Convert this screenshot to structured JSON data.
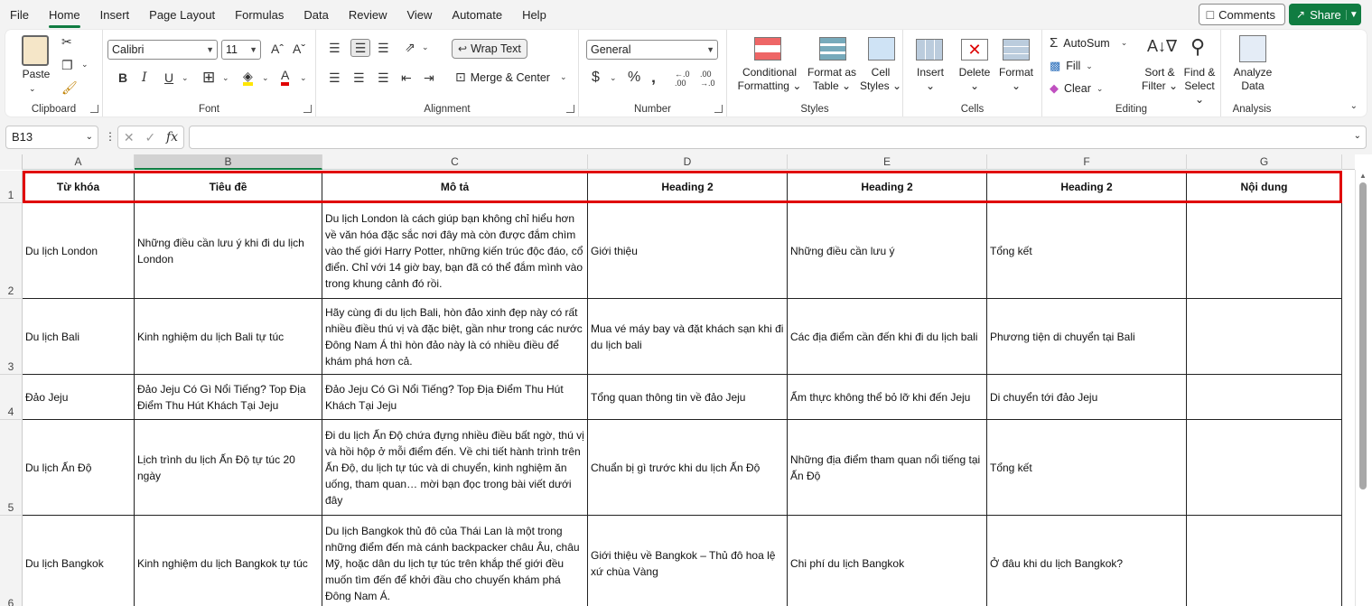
{
  "menu": {
    "tabs": [
      "File",
      "Home",
      "Insert",
      "Page Layout",
      "Formulas",
      "Data",
      "Review",
      "View",
      "Automate",
      "Help"
    ],
    "active": "Home",
    "comments_label": "Comments",
    "share_label": "Share"
  },
  "ribbon": {
    "clipboard": {
      "label": "Clipboard",
      "paste": "Paste"
    },
    "font": {
      "label": "Font",
      "font_name": "Calibri",
      "font_size": "11"
    },
    "alignment": {
      "label": "Alignment",
      "wrap_text": "Wrap Text",
      "merge_center": "Merge & Center"
    },
    "number": {
      "label": "Number",
      "format": "General"
    },
    "styles": {
      "label": "Styles",
      "conditional": "Conditional",
      "conditional2": "Formatting",
      "format_as": "Format as",
      "table": "Table",
      "cell": "Cell",
      "cell_styles": "Styles"
    },
    "cells": {
      "label": "Cells",
      "insert": "Insert",
      "delete": "Delete",
      "format": "Format"
    },
    "editing": {
      "label": "Editing",
      "autosum": "AutoSum",
      "fill": "Fill",
      "clear": "Clear",
      "sort": "Sort &",
      "filter": "Filter",
      "find": "Find &",
      "select": "Select"
    },
    "analysis": {
      "label": "Analysis",
      "analyze": "Analyze",
      "data": "Data"
    }
  },
  "formula_bar": {
    "name_box": "B13",
    "formula": ""
  },
  "columns": [
    "A",
    "B",
    "C",
    "D",
    "E",
    "F",
    "G"
  ],
  "selected_column": "B",
  "rows": [
    {
      "num": "1",
      "cells": [
        "Từ khóa",
        "Tiêu đề",
        "Mô tả",
        "Heading 2",
        "Heading 2",
        "Heading 2",
        "Nội dung"
      ]
    },
    {
      "num": "2",
      "cells": [
        "Du lịch London",
        "Những điều cần lưu ý khi đi du lịch London",
        "Du lịch London là cách giúp bạn không chỉ hiểu hơn về văn hóa đặc sắc nơi đây mà còn được đắm chìm vào thế giới Harry Potter, những kiến trúc độc đáo, cổ điển. Chỉ với 14 giờ bay, bạn đã có thể đắm mình vào trong khung cảnh đó rồi.",
        "Giới thiệu",
        "Những điều cần lưu ý",
        "Tổng kết",
        ""
      ]
    },
    {
      "num": "3",
      "cells": [
        "Du lịch Bali",
        "Kinh nghiệm du lịch Bali tự túc",
        "Hãy cùng đi du lịch Bali, hòn đảo xinh đẹp này có rất nhiều điều thú vị và đặc biệt, gần như trong các nước Đông Nam Á thì hòn đảo này là có nhiều điều để khám phá hơn cả.",
        "Mua vé máy bay và đặt khách sạn khi đi du lịch bali",
        "Các địa điểm cần đến khi đi du lịch bali",
        "Phương tiện di chuyển tại Bali",
        ""
      ]
    },
    {
      "num": "4",
      "cells": [
        "Đảo Jeju",
        "Đảo Jeju Có Gì Nổi Tiếng? Top Địa Điểm Thu Hút Khách Tại Jeju",
        "Đảo Jeju Có Gì Nổi Tiếng? Top Địa Điểm Thu Hút Khách Tại Jeju",
        "Tổng quan thông tin về đảo Jeju",
        "Ẩm thực không thể bỏ lỡ khi đến Jeju",
        "Di chuyển tới đảo Jeju",
        ""
      ]
    },
    {
      "num": "5",
      "cells": [
        "Du lịch Ấn Độ",
        "Lịch trình du lịch Ấn Độ tự túc 20 ngày",
        "Đi du lịch Ấn Độ chứa đựng nhiều điều bất ngờ, thú vị và hồi hộp ở mỗi điểm đến. Về chi tiết hành trình trên Ấn Độ, du lịch tự túc và di chuyển, kinh nghiệm ăn uống, tham quan… mời bạn đọc trong bài viết dưới đây",
        "Chuẩn bị gì trước khi du lịch Ấn Độ",
        "Những địa điểm tham quan nổi tiếng tại Ấn Độ",
        "Tổng kết",
        ""
      ]
    },
    {
      "num": "6",
      "cells": [
        "Du lịch Bangkok",
        "Kinh nghiệm du lịch Bangkok tự túc",
        "Du lịch Bangkok thủ đô của Thái Lan là một trong những điểm đến mà cánh backpacker châu Âu, châu Mỹ, hoặc dân du lịch tự túc trên khắp thế giới đều muốn tìm đến để khởi đầu cho chuyến khám phá Đông Nam Á.",
        "Giới thiệu về Bangkok – Thủ đô hoa lệ xứ chùa Vàng",
        "Chi phí du lịch Bangkok",
        "Ở đâu khi du lịch Bangkok?",
        ""
      ]
    }
  ]
}
